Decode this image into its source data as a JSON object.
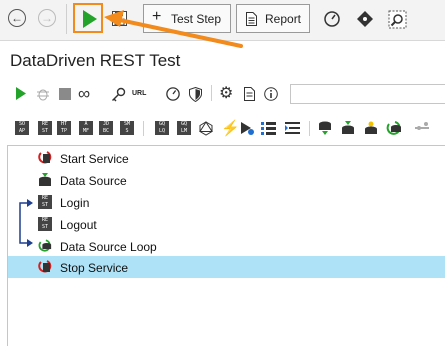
{
  "toolbar": {
    "test_step_label": "Test Step",
    "report_label": "Report"
  },
  "project": {
    "title": "DataDriven REST Test"
  },
  "url_label": "URL",
  "steps_toolbar": [
    {
      "name": "rest-request",
      "l1": "SO",
      "l2": "AP"
    },
    {
      "name": "rest-step",
      "l1": "RE",
      "l2": "ST"
    },
    {
      "name": "http-step",
      "l1": "HT",
      "l2": "TP"
    },
    {
      "name": "amf-step",
      "l1": "A",
      "l2": "MF"
    },
    {
      "name": "jdbc-step",
      "l1": "JD",
      "l2": "BC"
    },
    {
      "name": "sms-step",
      "l1": "SM",
      "l2": "S"
    },
    {
      "name": "graphql-query",
      "l1": "GQ",
      "l2": "LQ"
    },
    {
      "name": "graphql-mutation",
      "l1": "GQ",
      "l2": "LM"
    }
  ],
  "tree": [
    {
      "label": "Start Service",
      "icon": "start-service-icon"
    },
    {
      "label": "Data Source",
      "icon": "data-source-icon"
    },
    {
      "label": "Login",
      "icon": "rest-request-icon"
    },
    {
      "label": "Logout",
      "icon": "rest-request-icon"
    },
    {
      "label": "Data Source Loop",
      "icon": "data-source-loop-icon"
    },
    {
      "label": "Stop Service",
      "icon": "stop-service-icon"
    }
  ],
  "colors": {
    "accent_orange": "#f28a1c",
    "run_green": "#23a32a",
    "selection": "#aee2f7"
  }
}
